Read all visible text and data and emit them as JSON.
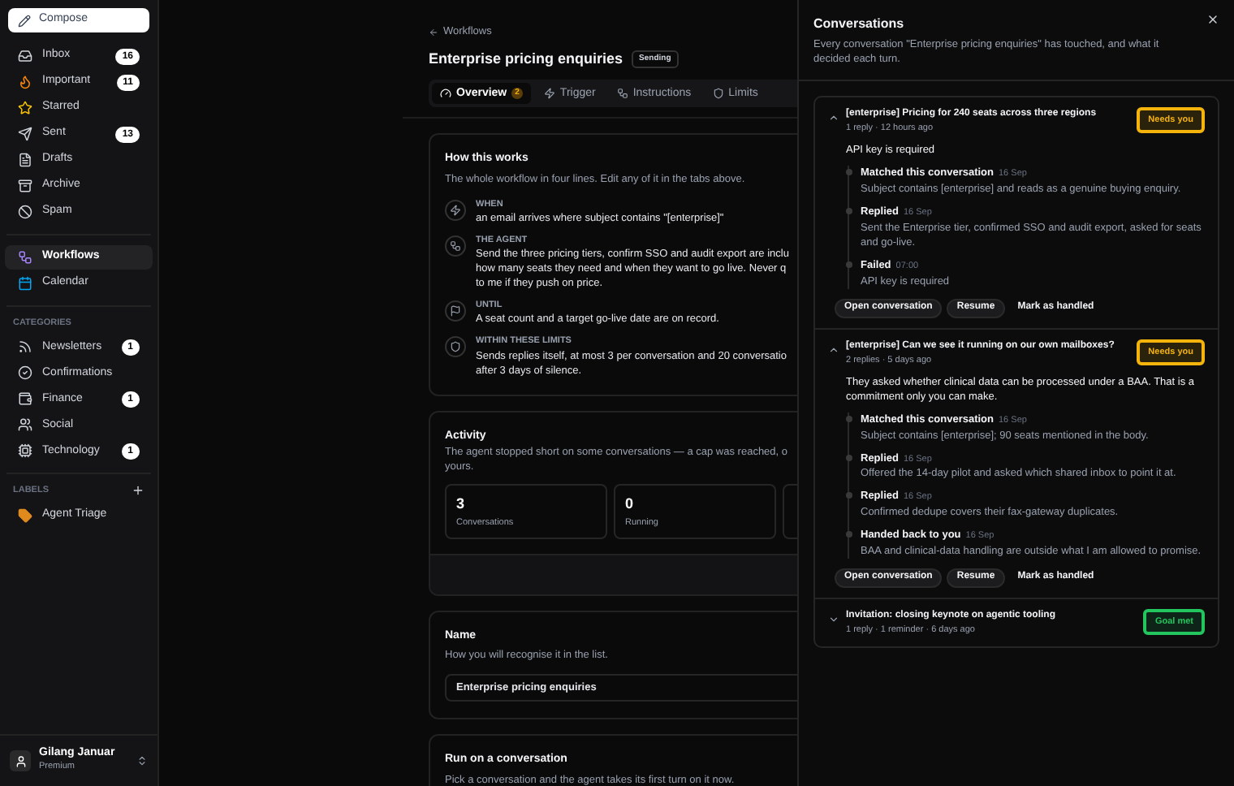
{
  "sidebar": {
    "compose": "Compose",
    "mail": [
      {
        "label": "Inbox",
        "count": "16",
        "selected": false
      },
      {
        "label": "Important",
        "count": "11",
        "selected": false
      },
      {
        "label": "Starred",
        "selected": false
      },
      {
        "label": "Sent",
        "count": "13",
        "selected": false
      },
      {
        "label": "Drafts",
        "selected": false
      },
      {
        "label": "Archive",
        "selected": false
      },
      {
        "label": "Spam",
        "selected": false
      }
    ],
    "apps": [
      {
        "label": "Workflows",
        "selected": true
      },
      {
        "label": "Calendar",
        "selected": false
      }
    ],
    "categories_heading": "CATEGORIES",
    "categories": [
      {
        "label": "Newsletters",
        "count": "1"
      },
      {
        "label": "Confirmations"
      },
      {
        "label": "Finance",
        "count": "1"
      },
      {
        "label": "Social"
      },
      {
        "label": "Technology",
        "count": "1"
      }
    ],
    "labels_heading": "LABELS",
    "labels": [
      {
        "label": "Agent Triage",
        "color": "#e08a1e"
      }
    ],
    "user": {
      "name": "Gilang Januar",
      "plan": "Premium"
    }
  },
  "workflow": {
    "back": "Workflows",
    "title": "Enterprise pricing enquiries",
    "status": "Sending",
    "tabs": [
      {
        "label": "Overview",
        "badge": "2",
        "selected": true
      },
      {
        "label": "Trigger",
        "selected": false
      },
      {
        "label": "Instructions",
        "selected": false
      },
      {
        "label": "Limits",
        "selected": false
      }
    ],
    "how": {
      "title": "How this works",
      "subtitle": "The whole workflow in four lines. Edit any of it in the tabs above.",
      "steps": [
        {
          "label": "WHEN",
          "lines": [
            "an email arrives where subject contains \"[enterprise]\""
          ]
        },
        {
          "label": "THE AGENT",
          "lines": [
            "Send the three pricing tiers, confirm SSO and audit export are inclu",
            "how many seats they need and when they want to go live. Never q",
            "to me if they push on price."
          ]
        },
        {
          "label": "UNTIL",
          "lines": [
            "A seat count and a target go-live date are on record."
          ]
        },
        {
          "label": "WITHIN THESE LIMITS",
          "lines": [
            "Sends replies itself, at most 3 per conversation and 20 conversatio",
            "after 3 days of silence."
          ]
        }
      ]
    },
    "activity": {
      "title": "Activity",
      "lines": [
        "The agent stopped short on some conversations — a cap was reached, o",
        "yours."
      ],
      "stats": [
        {
          "value": "3",
          "label": "Conversations"
        },
        {
          "value": "0",
          "label": "Running"
        }
      ]
    },
    "name": {
      "title": "Name",
      "subtitle": "How you will recognise it in the list.",
      "value": "Enterprise pricing enquiries"
    },
    "run": {
      "title": "Run on a conversation",
      "subtitle": "Pick a conversation and the agent takes its first turn on it now."
    }
  },
  "sheet": {
    "title": "Conversations",
    "subtitle": "Every conversation \"Enterprise pricing enquiries\" has touched, and what it decided each turn.",
    "conversations": [
      {
        "subject": "[enterprise] Pricing for 240 seats across three regions",
        "meta": "1 reply · 12 hours ago",
        "status": "Needs you",
        "color": "#f5b40b",
        "expanded": true,
        "summary": "API key is required",
        "events": [
          {
            "title": "Matched this conversation",
            "date": "16 Sep",
            "text": "Subject contains [enterprise] and reads as a genuine buying enquiry."
          },
          {
            "title": "Replied",
            "date": "16 Sep",
            "text": "Sent the Enterprise tier, confirmed SSO and audit export, asked for seats and go-live."
          },
          {
            "title": "Failed",
            "date": "07:00",
            "text": "API key is required"
          }
        ],
        "actions": [
          "Open conversation",
          "Resume",
          "Mark as handled"
        ]
      },
      {
        "subject": "[enterprise] Can we see it running on our own mailboxes?",
        "meta": "2 replies · 5 days ago",
        "status": "Needs you",
        "color": "#f5b40b",
        "expanded": true,
        "summary": "They asked whether clinical data can be processed under a BAA. That is a commitment only you can make.",
        "events": [
          {
            "title": "Matched this conversation",
            "date": "16 Sep",
            "text": "Subject contains [enterprise]; 90 seats mentioned in the body."
          },
          {
            "title": "Replied",
            "date": "16 Sep",
            "text": "Offered the 14-day pilot and asked which shared inbox to point it at."
          },
          {
            "title": "Replied",
            "date": "16 Sep",
            "text": "Confirmed dedupe covers their fax-gateway duplicates."
          },
          {
            "title": "Handed back to you",
            "date": "16 Sep",
            "text": "BAA and clinical-data handling are outside what I am allowed to promise."
          }
        ],
        "actions": [
          "Open conversation",
          "Resume",
          "Mark as handled"
        ]
      },
      {
        "subject": "Invitation: closing keynote on agentic tooling",
        "meta": "1 reply · 1 reminder · 6 days ago",
        "status": "Goal met",
        "color": "#22c55e",
        "expanded": false
      }
    ]
  }
}
